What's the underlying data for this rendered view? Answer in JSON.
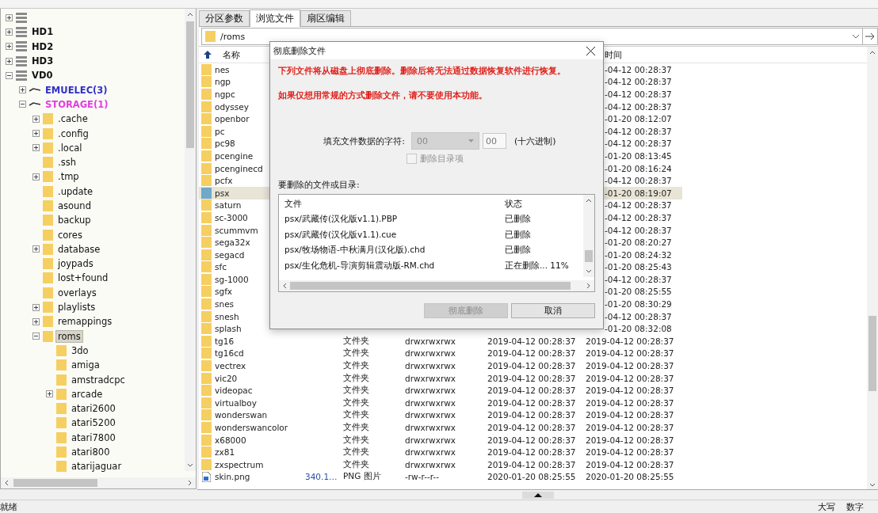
{
  "tree": {
    "items": [
      {
        "kind": "disk",
        "expanded": false,
        "selected": false
      },
      {
        "kind": "disk",
        "label": "HD1",
        "expanded": false,
        "selected": false
      },
      {
        "kind": "disk",
        "label": "HD2",
        "expanded": false,
        "selected": false
      },
      {
        "kind": "disk",
        "label": "HD3",
        "expanded": false,
        "selected": false
      },
      {
        "kind": "disk",
        "label": "VD0",
        "expanded": true,
        "selected": false,
        "children": [
          {
            "kind": "partition",
            "label": "EMUELEC(3)",
            "color": "#3030c8",
            "expanded": false,
            "selected": false
          },
          {
            "kind": "partition",
            "label": "STORAGE(1)",
            "color": "#e040e0",
            "expanded": true,
            "selected": false,
            "children": [
              {
                "kind": "folder",
                "label": ".cache",
                "expanded": false,
                "selected": false
              },
              {
                "kind": "folder",
                "label": ".config",
                "expanded": false,
                "selected": false
              },
              {
                "kind": "folder",
                "label": ".local",
                "expanded": false,
                "selected": false
              },
              {
                "kind": "folder",
                "label": ".ssh",
                "selected": false
              },
              {
                "kind": "folder",
                "label": ".tmp",
                "expanded": false,
                "selected": false
              },
              {
                "kind": "folder",
                "label": ".update",
                "selected": false
              },
              {
                "kind": "folder",
                "label": "asound",
                "selected": false
              },
              {
                "kind": "folder",
                "label": "backup",
                "selected": false
              },
              {
                "kind": "folder",
                "label": "cores",
                "selected": false
              },
              {
                "kind": "folder",
                "label": "database",
                "expanded": false,
                "selected": false
              },
              {
                "kind": "folder",
                "label": "joypads",
                "selected": false
              },
              {
                "kind": "folder",
                "label": "lost+found",
                "selected": false
              },
              {
                "kind": "folder",
                "label": "overlays",
                "selected": false
              },
              {
                "kind": "folder",
                "label": "playlists",
                "expanded": false,
                "selected": false
              },
              {
                "kind": "folder",
                "label": "remappings",
                "expanded": false,
                "selected": false
              },
              {
                "kind": "folder",
                "label": "roms",
                "expanded": true,
                "selected": true,
                "children": [
                  {
                    "kind": "folder",
                    "label": "3do",
                    "selected": false
                  },
                  {
                    "kind": "folder",
                    "label": "amiga",
                    "selected": false
                  },
                  {
                    "kind": "folder",
                    "label": "amstradcpc",
                    "selected": false
                  },
                  {
                    "kind": "folder",
                    "label": "arcade",
                    "expanded": false,
                    "selected": false
                  },
                  {
                    "kind": "folder",
                    "label": "atari2600",
                    "selected": false
                  },
                  {
                    "kind": "folder",
                    "label": "atari5200",
                    "selected": false
                  },
                  {
                    "kind": "folder",
                    "label": "atari7800",
                    "selected": false
                  },
                  {
                    "kind": "folder",
                    "label": "atari800",
                    "selected": false
                  },
                  {
                    "kind": "folder",
                    "label": "atarijaguar",
                    "selected": false
                  }
                ]
              }
            ]
          }
        ]
      }
    ]
  },
  "tabs": [
    {
      "label": "分区参数",
      "selected": false
    },
    {
      "label": "浏览文件",
      "selected": true
    },
    {
      "label": "扇区编辑",
      "selected": false
    }
  ],
  "path_bar": {
    "value": "/roms"
  },
  "file_table": {
    "name_label": "名称",
    "column_6_label": "时间",
    "rows": [
      {
        "kind": "folder",
        "name": "nes",
        "created_tail": "-04-12 00:28:37",
        "selected": false
      },
      {
        "kind": "folder",
        "name": "ngp",
        "created_tail": "-04-12 00:28:37",
        "selected": false
      },
      {
        "kind": "folder",
        "name": "ngpc",
        "created_tail": "-04-12 00:28:37",
        "selected": false
      },
      {
        "kind": "folder",
        "name": "odyssey",
        "created_tail": "-04-12 00:28:37",
        "selected": false
      },
      {
        "kind": "folder",
        "name": "openbor",
        "created_tail": "-01-20 08:12:07",
        "selected": false
      },
      {
        "kind": "folder",
        "name": "pc",
        "created_tail": "-04-12 00:28:37",
        "selected": false
      },
      {
        "kind": "folder",
        "name": "pc98",
        "created_tail": "-04-12 00:28:37",
        "selected": false
      },
      {
        "kind": "folder",
        "name": "pcengine",
        "created_tail": "-01-20 08:13:45",
        "selected": false
      },
      {
        "kind": "folder",
        "name": "pcenginecd",
        "created_tail": "-01-20 08:16:24",
        "selected": false
      },
      {
        "kind": "folder",
        "name": "pcfx",
        "created_tail": "-04-12 00:28:37",
        "selected": false
      },
      {
        "kind": "folder",
        "name": "psx",
        "created_tail": "-01-20 08:19:07",
        "selected": true
      },
      {
        "kind": "folder",
        "name": "saturn",
        "created_tail": "-04-12 00:28:37",
        "selected": false
      },
      {
        "kind": "folder",
        "name": "sc-3000",
        "created_tail": "-04-12 00:28:37",
        "selected": false
      },
      {
        "kind": "folder",
        "name": "scummvm",
        "created_tail": "-04-12 00:28:37",
        "selected": false
      },
      {
        "kind": "folder",
        "name": "sega32x",
        "created_tail": "-01-20 08:20:27",
        "selected": false
      },
      {
        "kind": "folder",
        "name": "segacd",
        "created_tail": "-01-20 08:24:32",
        "selected": false
      },
      {
        "kind": "folder",
        "name": "sfc",
        "created_tail": "-01-20 08:25:43",
        "selected": false
      },
      {
        "kind": "folder",
        "name": "sg-1000",
        "created_tail": "-04-12 00:28:37",
        "selected": false
      },
      {
        "kind": "folder",
        "name": "sgfx",
        "created_tail": "-01-20 08:25:55",
        "selected": false
      },
      {
        "kind": "folder",
        "name": "snes",
        "created_tail": "-01-20 08:30:29",
        "selected": false
      },
      {
        "kind": "folder",
        "name": "snesh",
        "created_tail": "-04-12 00:28:37",
        "selected": false
      },
      {
        "kind": "folder",
        "name": "splash",
        "created_tail": "-01-20 08:32:08",
        "selected": false
      },
      {
        "kind": "folder",
        "name": "tg16",
        "type": "文件夹",
        "attributes": "drwxrwxrwx",
        "modified": "2019-04-12 00:28:37",
        "created": "2019-04-12 00:28:37",
        "selected": false
      },
      {
        "kind": "folder",
        "name": "tg16cd",
        "type": "文件夹",
        "attributes": "drwxrwxrwx",
        "modified": "2019-04-12 00:28:37",
        "created": "2019-04-12 00:28:37",
        "selected": false
      },
      {
        "kind": "folder",
        "name": "vectrex",
        "type": "文件夹",
        "attributes": "drwxrwxrwx",
        "modified": "2019-04-12 00:28:37",
        "created": "2019-04-12 00:28:37",
        "selected": false
      },
      {
        "kind": "folder",
        "name": "vic20",
        "type": "文件夹",
        "attributes": "drwxrwxrwx",
        "modified": "2019-04-12 00:28:37",
        "created": "2019-04-12 00:28:37",
        "selected": false
      },
      {
        "kind": "folder",
        "name": "videopac",
        "type": "文件夹",
        "attributes": "drwxrwxrwx",
        "modified": "2019-04-12 00:28:37",
        "created": "2019-04-12 00:28:37",
        "selected": false
      },
      {
        "kind": "folder",
        "name": "virtualboy",
        "type": "文件夹",
        "attributes": "drwxrwxrwx",
        "modified": "2019-04-12 00:28:37",
        "created": "2019-04-12 00:28:37",
        "selected": false
      },
      {
        "kind": "folder",
        "name": "wonderswan",
        "type": "文件夹",
        "attributes": "drwxrwxrwx",
        "modified": "2019-04-12 00:28:37",
        "created": "2019-04-12 00:28:37",
        "selected": false
      },
      {
        "kind": "folder",
        "name": "wonderswancolor",
        "type": "文件夹",
        "attributes": "drwxrwxrwx",
        "modified": "2019-04-12 00:28:37",
        "created": "2019-04-12 00:28:37",
        "selected": false
      },
      {
        "kind": "folder",
        "name": "x68000",
        "type": "文件夹",
        "attributes": "drwxrwxrwx",
        "modified": "2019-04-12 00:28:37",
        "created": "2019-04-12 00:28:37",
        "selected": false
      },
      {
        "kind": "folder",
        "name": "zx81",
        "type": "文件夹",
        "attributes": "drwxrwxrwx",
        "modified": "2019-04-12 00:28:37",
        "created": "2019-04-12 00:28:37",
        "selected": false
      },
      {
        "kind": "folder",
        "name": "zxspectrum",
        "type": "文件夹",
        "attributes": "drwxrwxrwx",
        "modified": "2019-04-12 00:28:37",
        "created": "2019-04-12 00:28:37",
        "selected": false
      },
      {
        "kind": "file",
        "name": "skin.png",
        "size": "340.1…",
        "type": "PNG 图片",
        "attributes": "-rw-r--r--",
        "modified": "2020-01-20 08:25:55",
        "created": "2020-01-20 08:25:55",
        "selected": false
      }
    ]
  },
  "dialog": {
    "title": "彻底删除文件",
    "warnings": [
      "下列文件将从磁盘上彻底删除。删除后将无法通过数据恢复软件进行恢复。",
      "如果仅想用常规的方式删除文件，请不要使用本功能。"
    ],
    "fill_label": "填充文件数据的字符:",
    "fill_select": {
      "value": "00",
      "disabled": true
    },
    "fill_input": {
      "value": "00"
    },
    "fill_unit": "(十六进制)",
    "checkbox": {
      "label": "删除目录项",
      "checked": false,
      "disabled": true
    },
    "list_label": "要删除的文件或目录:",
    "list": {
      "columns": [
        "文件",
        "状态"
      ],
      "rows": [
        {
          "file": "psx/武藏传(汉化版v1.1).PBP",
          "status": "已删除"
        },
        {
          "file": "psx/武藏传(汉化版v1.1).cue",
          "status": "已删除"
        },
        {
          "file": "psx/牧场物语-中秋满月(汉化版).chd",
          "status": "已删除"
        },
        {
          "file": "psx/生化危机-导演剪辑震动版-RM.chd",
          "status": "正在删除... 11%"
        }
      ]
    },
    "buttons": [
      {
        "label": "彻底删除",
        "disabled": true
      },
      {
        "label": "取消",
        "disabled": false
      }
    ]
  },
  "status_bar": {
    "message": "就绪",
    "indicators": [
      "大写",
      "数字"
    ]
  }
}
